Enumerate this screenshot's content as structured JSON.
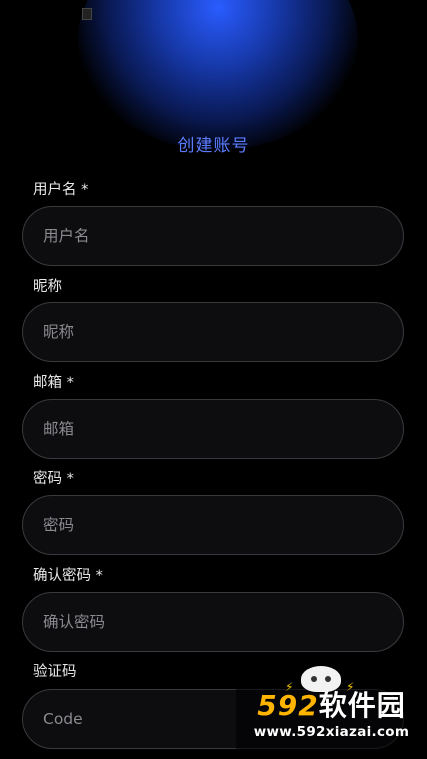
{
  "title": "创建账号",
  "fields": [
    {
      "label": "用户名 *",
      "placeholder": "用户名"
    },
    {
      "label": "昵称",
      "placeholder": "昵称"
    },
    {
      "label": "邮箱 *",
      "placeholder": "邮箱"
    },
    {
      "label": "密码 *",
      "placeholder": "密码"
    },
    {
      "label": "确认密码 *",
      "placeholder": "确认密码"
    },
    {
      "label": "验证码",
      "placeholder": "Code"
    }
  ],
  "watermark": {
    "brand_num": "592",
    "brand_text": "软件园",
    "url": "www.592xiazai.com"
  },
  "colors": {
    "accent": "#5b7cff",
    "background": "#000000",
    "input_bg": "#0d0d10",
    "input_border": "#3a3a3e"
  }
}
